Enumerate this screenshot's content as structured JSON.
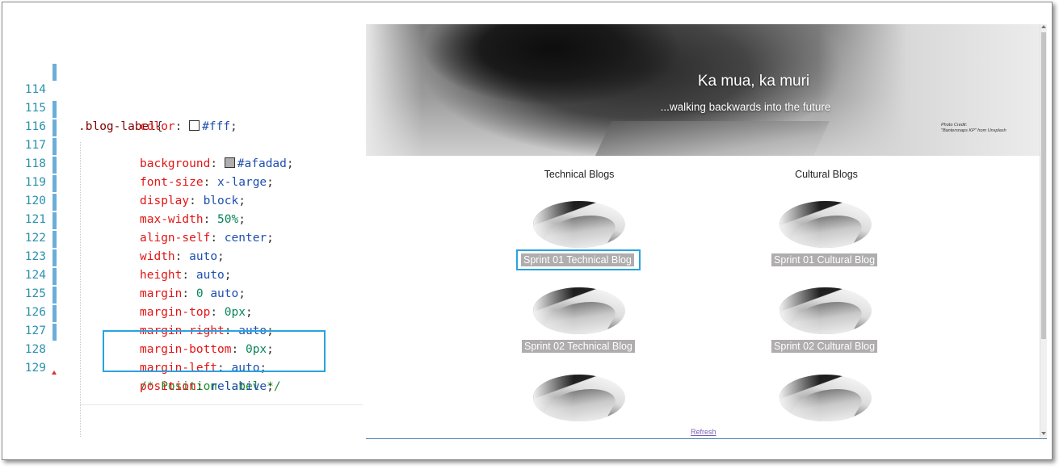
{
  "editor": {
    "lines": [
      {
        "num": "114",
        "selector": ".blog-label",
        "brace": "{"
      },
      {
        "num": "115",
        "prop": "color",
        "value": "#fff"
      },
      {
        "num": "116",
        "prop": "background",
        "value": "#afadad"
      },
      {
        "num": "117",
        "prop": "font-size",
        "value": "x-large"
      },
      {
        "num": "118",
        "prop": "display",
        "value": "block"
      },
      {
        "num": "119",
        "prop": "max-width",
        "value": "50%"
      },
      {
        "num": "120",
        "prop": "align-self",
        "value": "center"
      },
      {
        "num": "121",
        "prop": "width",
        "value": "auto"
      },
      {
        "num": "122",
        "prop": "height",
        "value": "auto"
      },
      {
        "num": "123",
        "prop": "margin",
        "value_num": "0",
        "value": "auto"
      },
      {
        "num": "124",
        "prop": "margin-top",
        "value": "0px"
      },
      {
        "num": "125",
        "prop": "margin-right",
        "value": "auto"
      },
      {
        "num": "126",
        "prop": "margin-bottom",
        "value": "0px"
      },
      {
        "num": "127",
        "prop": "margin-left",
        "value": "auto"
      },
      {
        "num": "128",
        "comment": "/* Position label */"
      },
      {
        "num": "129",
        "prop": "position",
        "value": "relative"
      }
    ],
    "swatch_colors": {
      "white": "#ffffff",
      "grey": "#afadad"
    },
    "highlight_color": "#29a3e0"
  },
  "preview": {
    "hero": {
      "title": "Ka mua, ka muri",
      "subtitle": "...walking backwards into the future",
      "credit_line1": "Photo Credit:",
      "credit_line2": "\"Bantersnaps KP\" from Unsplash"
    },
    "columns": [
      {
        "heading": "Technical Blogs",
        "labels": [
          "Sprint 01 Technical Blog",
          "Sprint 02 Technical Blog"
        ]
      },
      {
        "heading": "Cultural Blogs",
        "labels": [
          "Sprint 01 Cultural Blog",
          "Sprint 02 Cultural Blog"
        ]
      }
    ],
    "refresh_link": "Refresh",
    "label_background": "#afadad"
  }
}
